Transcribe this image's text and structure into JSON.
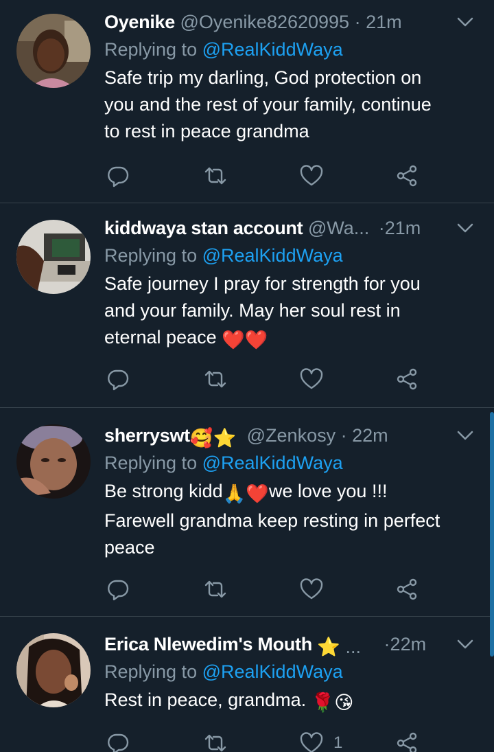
{
  "tweets": [
    {
      "display_name": "Oyenike",
      "handle": "@Oyenike82620995",
      "time": "21m",
      "replying_prefix": "Replying to",
      "replying_to": "@RealKiddWaya",
      "lines": [
        "Safe trip my darling, God protection on",
        "you and the rest of your family, continue",
        "to rest in peace grandma"
      ],
      "like_count": ""
    },
    {
      "display_name": "kiddwaya stan account",
      "handle": "@Wa...",
      "time": "21m",
      "replying_prefix": "Replying to",
      "replying_to": "@RealKiddWaya",
      "lines": [
        "Safe journey I pray for strength for you",
        "and your family. May her soul rest in",
        "eternal peace"
      ],
      "emoji_after": "❤️❤️",
      "like_count": ""
    },
    {
      "display_name": "sherryswt",
      "name_emoji": "🥰⭐",
      "handle": "@Zenkosy",
      "time": "22m",
      "replying_prefix": "Replying to",
      "replying_to": "@RealKiddWaya",
      "line1_a": "Be strong kidd",
      "line1_emoji": "🙏❤️",
      "line1_b": "we love you !!!",
      "lines": [
        "Farewell grandma keep resting in perfect",
        "peace"
      ],
      "like_count": ""
    },
    {
      "display_name": "Erica Nlewedim's Mouth",
      "name_emoji": "⭐ ...",
      "handle": "",
      "time": "22m",
      "replying_prefix": "Replying to",
      "replying_to": "@RealKiddWaya",
      "lines": [
        "Rest in peace, grandma."
      ],
      "emoji_after": "🌹😘",
      "like_count": "1"
    }
  ],
  "colors": {
    "background": "#15202b",
    "secondary_text": "#8899a6",
    "link": "#1da1f2",
    "divider": "#38444d",
    "heart": "#e0245e"
  },
  "icons": [
    "reply-icon",
    "retweet-icon",
    "like-icon",
    "share-icon",
    "chevron-down-icon"
  ]
}
